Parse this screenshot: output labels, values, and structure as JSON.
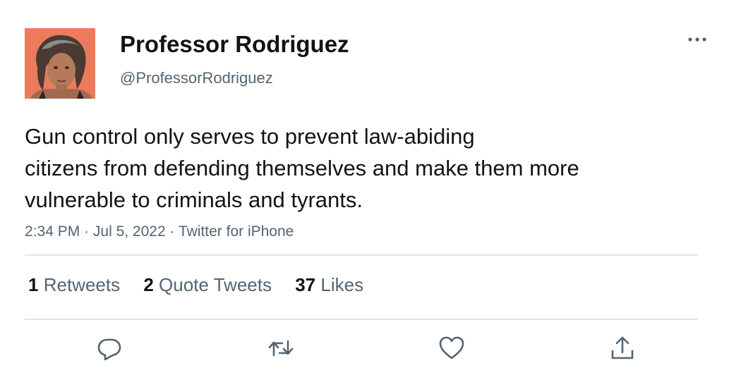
{
  "user": {
    "display_name": "Professor Rodriguez",
    "handle": "@ProfessorRodriguez",
    "avatar_bg": "#e8714f"
  },
  "tweet": {
    "text_lines": [
      "Gun control only serves to prevent law-abiding",
      "citizens from defending themselves and make them more",
      "vulnerable to criminals and tyrants."
    ],
    "time": "2:34 PM",
    "separator": " · ",
    "date": "Jul 5, 2022",
    "source": "Twitter for iPhone"
  },
  "stats": {
    "retweets": {
      "count": "1",
      "label": "Retweets"
    },
    "quotes": {
      "count": "2",
      "label": "Quote Tweets"
    },
    "likes": {
      "count": "37",
      "label": "Likes"
    }
  },
  "actions": {
    "reply_icon": "reply-icon",
    "retweet_icon": "retweet-icon",
    "like_icon": "heart-icon",
    "share_icon": "share-icon",
    "more_icon": "more-icon"
  },
  "colors": {
    "primary_text": "#0f1419",
    "secondary_text": "#536471",
    "divider": "#e1e4e8"
  }
}
